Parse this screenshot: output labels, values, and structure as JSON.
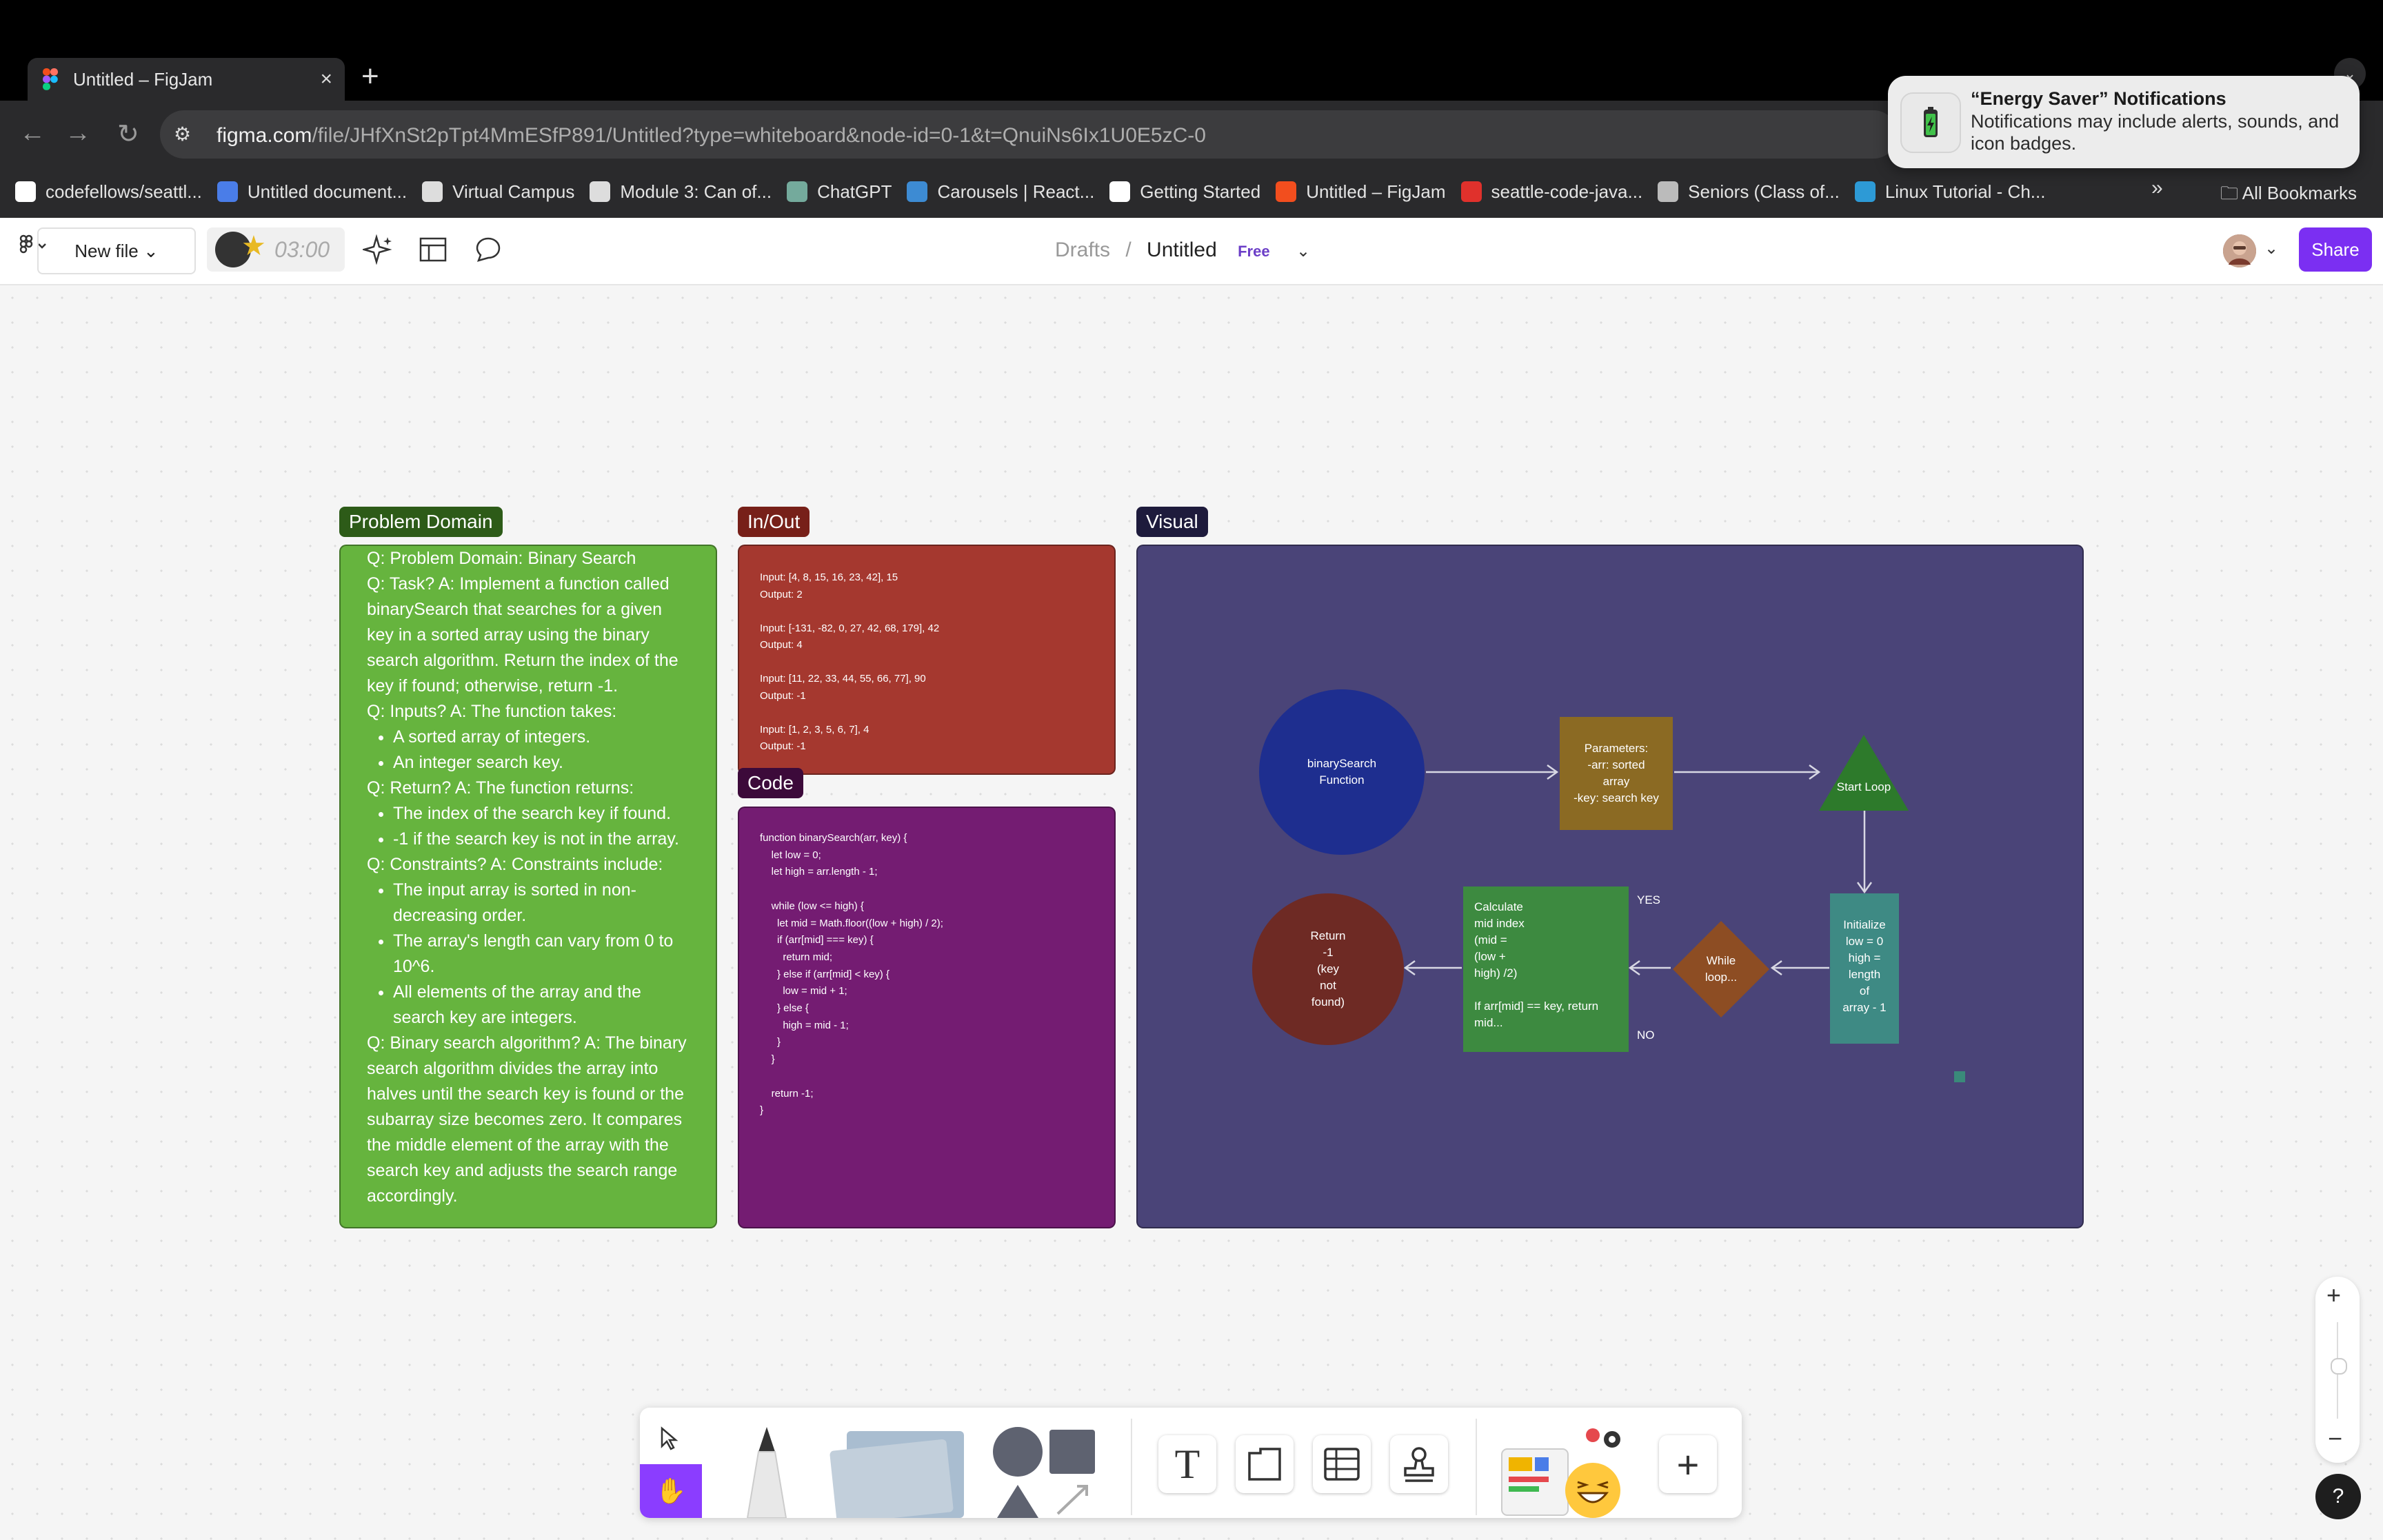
{
  "browser": {
    "tab_title": "Untitled – FigJam",
    "tab_close": "×",
    "new_tab": "+",
    "url_host": "figma.com",
    "url_path": "/file/JHfXnSt2pTpt4MmESfP891/Untitled?type=whiteboard&node-id=0-1&t=QnuiNs6Ix1U0E5zC-0",
    "bookmarks": [
      {
        "label": "codefellows/seattl...",
        "color": "#ffffff"
      },
      {
        "label": "Untitled document...",
        "color": "#4a7de8"
      },
      {
        "label": "Virtual Campus",
        "color": "#dddddd"
      },
      {
        "label": "Module 3: Can of...",
        "color": "#dddddd"
      },
      {
        "label": "ChatGPT",
        "color": "#74aa9c"
      },
      {
        "label": "Carousels | React...",
        "color": "#3d8bd3"
      },
      {
        "label": "Getting Started",
        "color": "#ffffff"
      },
      {
        "label": "Untitled – FigJam",
        "color": "#f24e1e"
      },
      {
        "label": "seattle-code-java...",
        "color": "#e0312c"
      },
      {
        "label": "Seniors (Class of...",
        "color": "#bbbbbb"
      },
      {
        "label": "Linux Tutorial - Ch...",
        "color": "#2d9ad6"
      }
    ],
    "bookmarks_more": "»",
    "all_bookmarks": "All Bookmarks"
  },
  "notification": {
    "title": "“Energy Saver” Notifications",
    "body": "Notifications may include alerts, sounds, and icon badges."
  },
  "figjam": {
    "new_file": "New file",
    "timer": "03:00",
    "breadcrumb_parent": "Drafts",
    "breadcrumb_sep": "/",
    "file_name": "Untitled",
    "plan_badge": "Free",
    "share": "Share"
  },
  "sections": {
    "problem_domain": {
      "label": "Problem Domain",
      "lines": [
        "Q: Problem Domain: Binary Search",
        "Q: Task? A: Implement a function called binarySearch that searches for a given key in a sorted array using the binary search algorithm. Return the index of the key if found; otherwise, return -1.",
        "Q: Inputs? A: The function takes:"
      ],
      "inputs_bullets": [
        "A sorted array of integers.",
        "An integer search key."
      ],
      "return_line": "Q: Return? A: The function returns:",
      "return_bullets": [
        "The index of the search key if found.",
        "-1 if the search key is not in the array."
      ],
      "constraints_line": "Q: Constraints? A: Constraints include:",
      "constraints_bullets": [
        "The input array is sorted in non-decreasing order.",
        "The array's length can vary from 0 to 10^6.",
        "All elements of the array and the search key are integers."
      ],
      "algorithm_line": "Q: Binary search algorithm? A: The binary search algorithm divides the array into halves until the search key is found or the subarray size becomes zero. It compares the middle element of the array with the search key and adjusts the search range accordingly."
    },
    "in_out": {
      "label": "In/Out",
      "text": "Input: [4, 8, 15, 16, 23, 42], 15\nOutput: 2\n\nInput: [-131, -82, 0, 27, 42, 68, 179], 42\nOutput: 4\n\nInput: [11, 22, 33, 44, 55, 66, 77], 90\nOutput: -1\n\nInput: [1, 2, 3, 5, 6, 7], 4\nOutput: -1"
    },
    "code": {
      "label": "Code",
      "text": "function binarySearch(arr, key) {\n    let low = 0;\n    let high = arr.length - 1;\n\n    while (low <= high) {\n      let mid = Math.floor((low + high) / 2);\n      if (arr[mid] === key) {\n        return mid;\n      } else if (arr[mid] < key) {\n        low = mid + 1;\n      } else {\n        high = mid - 1;\n      }\n    }\n\n    return -1;\n}"
    },
    "visual": {
      "label": "Visual",
      "nodes": {
        "binary_search": "binarySearch\nFunction",
        "parameters": "Parameters:\n-arr: sorted\narray\n-key: search key",
        "start_loop": "Start Loop",
        "initialize": "Initialize\nlow = 0\nhigh =\nlength\nof\narray - 1",
        "while_loop": "While\nloop...",
        "calculate": "Calculate\nmid index\n(mid =\n(low +\nhigh) /2)\n\nIf arr[mid] == key, return\nmid...",
        "return_neg": "Return\n-1\n(key\nnot\nfound)",
        "yes": "YES",
        "no": "NO"
      }
    }
  },
  "colors": {
    "problem_domain": "#66b43e",
    "in_out": "#a5382f",
    "code": "#741c72",
    "visual": "#4a4478",
    "accent": "#7b2ff2"
  }
}
